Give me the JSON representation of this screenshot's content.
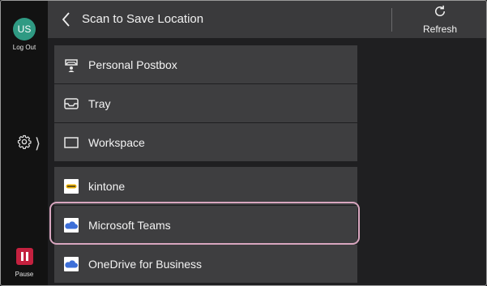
{
  "user": {
    "initials": "US",
    "logout_label": "Log Out"
  },
  "rail": {
    "pause_label": "Pause"
  },
  "header": {
    "title": "Scan to Save Location",
    "refresh_label": "Refresh"
  },
  "locations_group1": [
    {
      "label": "Personal Postbox",
      "icon": "postbox-icon"
    },
    {
      "label": "Tray",
      "icon": "tray-icon"
    },
    {
      "label": "Workspace",
      "icon": "workspace-icon"
    }
  ],
  "locations_group2": [
    {
      "label": "kintone",
      "icon": "kintone-icon"
    },
    {
      "label": "Microsoft Teams",
      "icon": "cloud-icon",
      "selected": true
    },
    {
      "label": "OneDrive for Business",
      "icon": "cloud-icon"
    }
  ],
  "colors": {
    "highlight": "#d8a6bf",
    "avatar": "#2f9a83",
    "pause": "#c4213f",
    "cloud": "#3d6fd8"
  }
}
